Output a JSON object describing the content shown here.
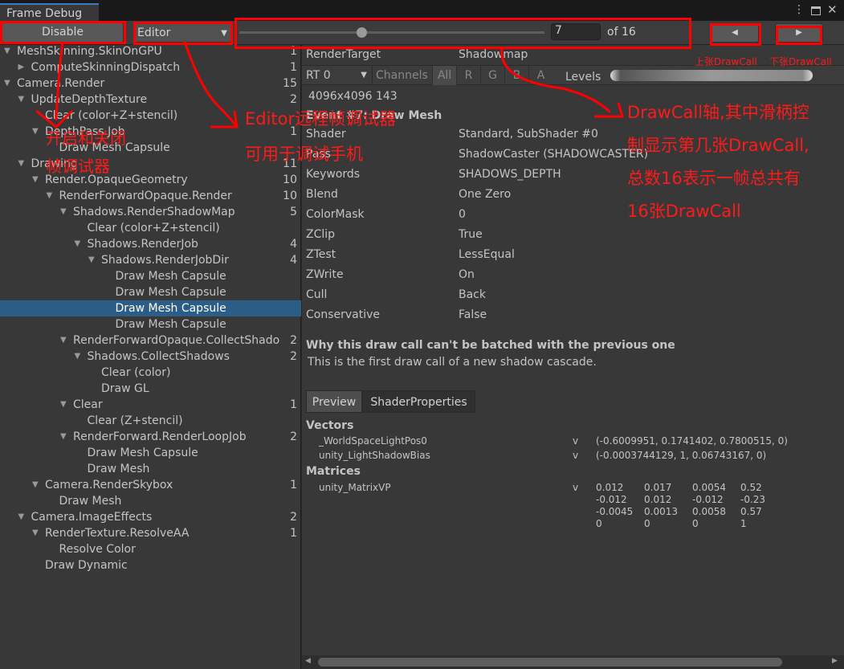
{
  "window": {
    "tab": "Frame Debug"
  },
  "toolbar": {
    "disable": "Disable",
    "target": "Editor",
    "current": "7",
    "of": "of 16",
    "slider_fraction": 0.4
  },
  "tree": [
    [
      "MeshSkinning.SkinOnGPU",
      "1",
      0,
      "down"
    ],
    [
      "ComputeSkinningDispatch",
      "1",
      1,
      "right"
    ],
    [
      "Camera.Render",
      "15",
      0,
      "down"
    ],
    [
      "UpdateDepthTexture",
      "2",
      1,
      "down"
    ],
    [
      "Clear (color+Z+stencil)",
      "",
      2,
      ""
    ],
    [
      "DepthPass.Job",
      "1",
      2,
      "down"
    ],
    [
      "Draw Mesh Capsule",
      "",
      3,
      ""
    ],
    [
      "Drawing",
      "11",
      1,
      "down"
    ],
    [
      "Render.OpaqueGeometry",
      "10",
      2,
      "down"
    ],
    [
      "RenderForwardOpaque.Render",
      "10",
      3,
      "down"
    ],
    [
      "Shadows.RenderShadowMap",
      "5",
      4,
      "down"
    ],
    [
      "Clear (color+Z+stencil)",
      "",
      5,
      ""
    ],
    [
      "Shadows.RenderJob",
      "4",
      5,
      "down"
    ],
    [
      "Shadows.RenderJobDir",
      "4",
      6,
      "down"
    ],
    [
      "Draw Mesh Capsule",
      "",
      7,
      ""
    ],
    [
      "Draw Mesh Capsule",
      "",
      7,
      ""
    ],
    [
      "Draw Mesh Capsule",
      "",
      7,
      "",
      "selected"
    ],
    [
      "Draw Mesh Capsule",
      "",
      7,
      ""
    ],
    [
      "RenderForwardOpaque.CollectShado",
      "2",
      4,
      "down"
    ],
    [
      "Shadows.CollectShadows",
      "2",
      5,
      "down"
    ],
    [
      "Clear (color)",
      "",
      6,
      ""
    ],
    [
      "Draw GL",
      "",
      6,
      ""
    ],
    [
      "Clear",
      "1",
      4,
      "down"
    ],
    [
      "Clear (Z+stencil)",
      "",
      5,
      ""
    ],
    [
      "RenderForward.RenderLoopJob",
      "2",
      4,
      "down"
    ],
    [
      "Draw Mesh Capsule",
      "",
      5,
      ""
    ],
    [
      "Draw Mesh",
      "",
      5,
      ""
    ],
    [
      "Camera.RenderSkybox",
      "1",
      2,
      "down"
    ],
    [
      "Draw Mesh",
      "",
      3,
      ""
    ],
    [
      "Camera.ImageEffects",
      "2",
      1,
      "down"
    ],
    [
      "RenderTexture.ResolveAA",
      "1",
      2,
      "down"
    ],
    [
      "Resolve Color",
      "",
      3,
      ""
    ],
    [
      "Draw Dynamic",
      "",
      2,
      ""
    ]
  ],
  "rt": {
    "label": "RenderTarget",
    "value": "Shadowmap",
    "rt": "RT 0",
    "channels": "Channels",
    "ch": [
      "All",
      "R",
      "G",
      "B",
      "A"
    ],
    "levels": "Levels",
    "size": "4096x4096 143"
  },
  "event": "Event #7: Draw Mesh",
  "props": [
    [
      "Shader",
      "Standard, SubShader #0"
    ],
    [
      "Pass",
      "ShadowCaster (SHADOWCASTER)"
    ],
    [
      "Keywords",
      "SHADOWS_DEPTH"
    ],
    [
      "Blend",
      "One Zero"
    ],
    [
      "ColorMask",
      "0"
    ],
    [
      "ZClip",
      "True"
    ],
    [
      "ZTest",
      "LessEqual"
    ],
    [
      "ZWrite",
      "On"
    ],
    [
      "Cull",
      "Back"
    ],
    [
      "Conservative",
      "False"
    ]
  ],
  "batch": {
    "title": "Why this draw call can't be batched with the previous one",
    "text": "This is the first draw call of a new shadow cascade."
  },
  "tabs": [
    "Preview",
    "ShaderProperties"
  ],
  "vectors": {
    "title": "Vectors",
    "items": [
      [
        "_WorldSpaceLightPos0",
        "v",
        "(-0.6009951, 0.1741402, 0.7800515, 0)"
      ],
      [
        "unity_LightShadowBias",
        "v",
        "(-0.0003744129, 1, 0.06743167, 0)"
      ]
    ]
  },
  "matrices": {
    "title": "Matrices",
    "name": "unity_MatrixVP",
    "stage": "v",
    "rows": [
      [
        "0.012",
        "0.017",
        "0.0054",
        "0.52"
      ],
      [
        "-0.012",
        "0.012",
        "-0.012",
        "-0.23"
      ],
      [
        "-0.0045",
        "0.0013",
        "0.0058",
        "0.57"
      ],
      [
        "0",
        "0",
        "0",
        "1"
      ]
    ]
  },
  "annotations": {
    "disable": "开启和关闭\n帧调试器",
    "editor": "Editor远程帧调试器\n可用于调试手机",
    "prev": "上张DrawCall",
    "next": "下张DrawCall",
    "axis": "DrawCall轴,其中滑柄控\n制显示第几张DrawCall,\n总数16表示一帧总共有\n16张DrawCall",
    "color": "#ff1a1a"
  }
}
